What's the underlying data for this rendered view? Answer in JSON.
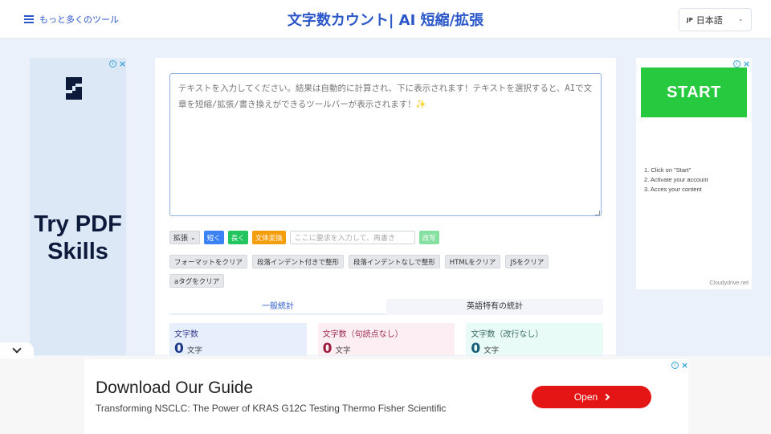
{
  "header": {
    "more_tools": "もっと多くのツール",
    "title": "文字数カウント| AI 短縮/拡張",
    "language": {
      "code": "JP",
      "label": "日本語"
    }
  },
  "ad_left": {
    "headline": "Try PDF Skills",
    "logo_icon": "s-logo-icon"
  },
  "ad_right": {
    "button": "START",
    "steps": [
      "1. Click on \"Start\"",
      "2. Activate your account",
      "3. Acces your content"
    ],
    "brand": "Cloudydrive.net"
  },
  "editor": {
    "placeholder": "テキストを入力してください。結果は自動的に計算され、下に表示されます！テキストを選択すると、AIで文章を短縮/拡張/書き換えができるツールバーが表示されます！✨"
  },
  "toolbar": {
    "mode_select": "拡張",
    "short_button": "短く",
    "long_button": "長く",
    "style_button": "文体変換",
    "request_placeholder": "ここに要求を入力して、再書き",
    "rewrite_button": "改写"
  },
  "clear_buttons": [
    "フォーマットをクリア",
    "段落インデント付きで整形",
    "段落インデントなしで整形",
    "HTMLをクリア",
    "JSをクリア",
    "aタグをクリア"
  ],
  "stats": {
    "tabs": [
      "一般統計",
      "英語特有の統計"
    ],
    "cards": [
      {
        "label": "文字数",
        "value": "0",
        "unit": "文字"
      },
      {
        "label": "文字数（句読点なし）",
        "value": "0",
        "unit": "文字"
      },
      {
        "label": "文字数（改行なし）",
        "value": "0",
        "unit": "文字"
      }
    ]
  },
  "bottom_ad": {
    "headline": "Download Our Guide",
    "subtext": "Transforming NSCLC: The Power of KRAS G12C Testing Thermo Fisher Scientific",
    "button": "Open"
  },
  "colors": {
    "brand": "#2b57c9",
    "start_green": "#27c93f",
    "open_red": "#e31515"
  }
}
